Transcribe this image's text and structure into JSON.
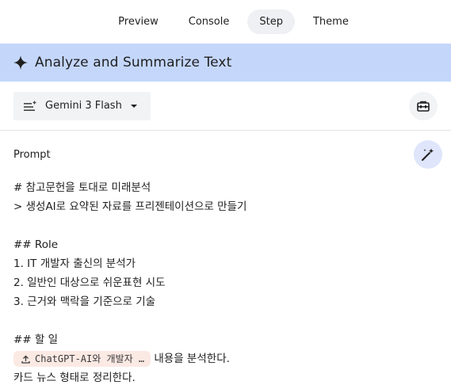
{
  "tabs": [
    {
      "label": "Preview",
      "active": false
    },
    {
      "label": "Console",
      "active": false
    },
    {
      "label": "Step",
      "active": true
    },
    {
      "label": "Theme",
      "active": false
    }
  ],
  "step": {
    "title": "Analyze and Summarize Text",
    "icon": "sparkle-icon",
    "header_color": "#c4d7fb"
  },
  "toolbar": {
    "model_label": "Gemini 3 Flash",
    "model_icon": "model-settings-icon",
    "tools_icon": "toolbox-icon"
  },
  "prompt": {
    "label": "Prompt",
    "magic_icon": "magic-wand-icon",
    "lines": [
      "# 참고문헌을 토대로 미래분석",
      "> 생성AI로 요약된 자료를 프리젠테이션으로 만들기",
      "",
      "## Role",
      "1. IT 개발자 출신의 분석가",
      "2. 일반인 대상으로 쉬운표현 시도",
      "3. 근거와 맥락을 기준으로 기술",
      "",
      "## 할 일"
    ],
    "chip_text": "ChatGPT-AI와 개발자 …",
    "chip_icon": "upload-icon",
    "chip_suffix": " 내용을 분석한다.",
    "last_line": "카드 뉴스 형태로 정리한다."
  }
}
